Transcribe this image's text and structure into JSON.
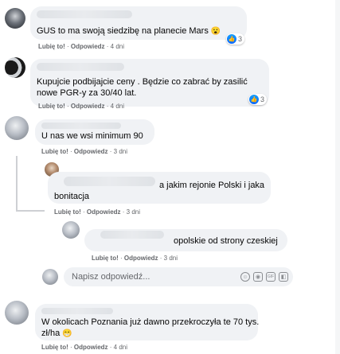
{
  "actions": {
    "like": "Lubię to!",
    "reply": "Odpowiedz",
    "sep": " · "
  },
  "comments": [
    {
      "text": "GUS to ma swoją siedzibę na planecie Mars",
      "emoji": "😮",
      "age": "4 dni",
      "reaction_count": "3"
    },
    {
      "text_line1": "Kupujcie podbijajcie ceny . Będzie co zabrać by zasilić",
      "text_line2": "nowe PGR-y za 30/40 lat.",
      "age": "4 dni",
      "reaction_count": "3"
    },
    {
      "text": "U nas we wsi minimum 90",
      "age": "3 dni"
    },
    {
      "text_line1": "a jakim rejonie Polski i jaka",
      "text_line2": "bonitacja",
      "age": "3 dni"
    },
    {
      "text": "opolskie od strony czeskiej",
      "age": "3 dni"
    },
    {
      "text_line1": "W okolicach Poznania już dawno przekroczyła te 70 tys.",
      "text_line2": "zł/ha",
      "emoji": "😁",
      "age": "4 dni"
    }
  ],
  "reply_input": {
    "placeholder": "Napisz odpowiedź..."
  },
  "icons": {
    "input_emoji": "smile-icon",
    "input_camera": "camera-icon",
    "input_gif": "gif-icon",
    "input_sticker": "sticker-icon",
    "reaction": "like-icon"
  },
  "colors": {
    "bubble": "#f0f2f5",
    "meta_text": "#65676b",
    "like_blue": "#0866ff",
    "thread_line": "#ced0d4"
  }
}
